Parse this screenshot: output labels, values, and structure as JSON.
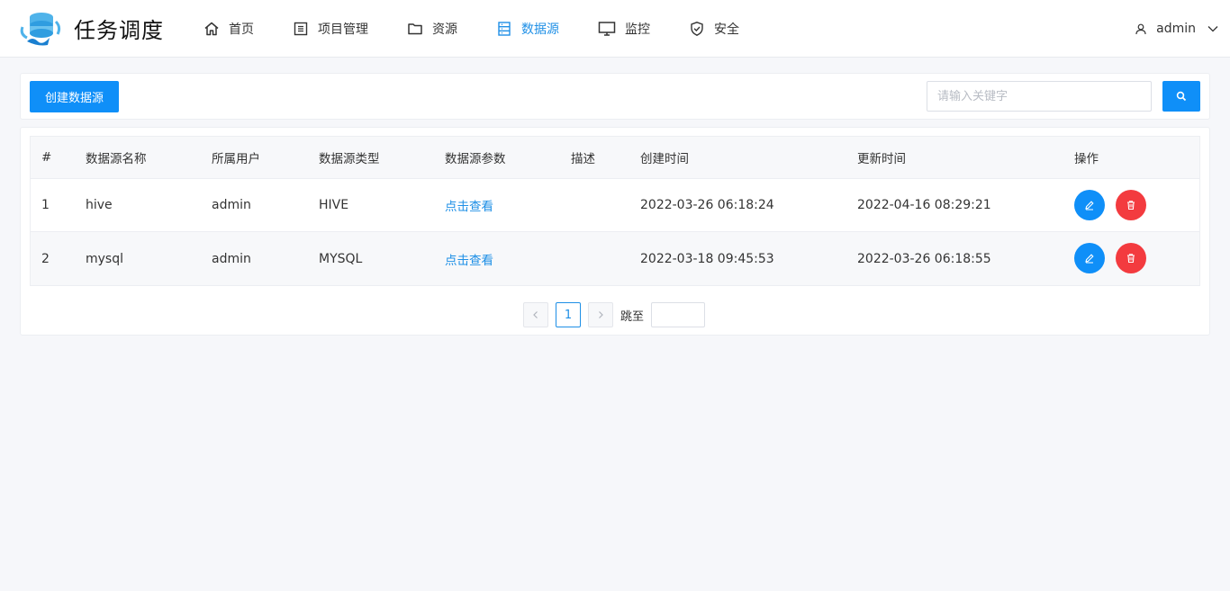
{
  "app": {
    "title": "任务调度"
  },
  "nav": [
    {
      "label": "首页",
      "icon": "home-icon"
    },
    {
      "label": "项目管理",
      "icon": "list-icon"
    },
    {
      "label": "资源",
      "icon": "folder-icon"
    },
    {
      "label": "数据源",
      "icon": "database-icon",
      "active": true
    },
    {
      "label": "监控",
      "icon": "monitor-icon"
    },
    {
      "label": "安全",
      "icon": "shield-icon"
    }
  ],
  "user": {
    "name": "admin"
  },
  "toolbar": {
    "create_label": "创建数据源",
    "search_placeholder": "请输入关键字"
  },
  "table": {
    "headers": [
      "#",
      "数据源名称",
      "所属用户",
      "数据源类型",
      "数据源参数",
      "描述",
      "创建时间",
      "更新时间",
      "操作"
    ],
    "rows": [
      {
        "index": "1",
        "name": "hive",
        "user": "admin",
        "type": "HIVE",
        "params": "点击查看",
        "desc": "",
        "created": "2022-03-26 06:18:24",
        "updated": "2022-04-16 08:29:21"
      },
      {
        "index": "2",
        "name": "mysql",
        "user": "admin",
        "type": "MYSQL",
        "params": "点击查看",
        "desc": "",
        "created": "2022-03-18 09:45:53",
        "updated": "2022-03-26 06:18:55"
      }
    ]
  },
  "pager": {
    "current": "1",
    "jump_label": "跳至"
  },
  "colors": {
    "primary": "#0f8ff8",
    "danger": "#f33b3f",
    "link": "#1e8fe6"
  }
}
